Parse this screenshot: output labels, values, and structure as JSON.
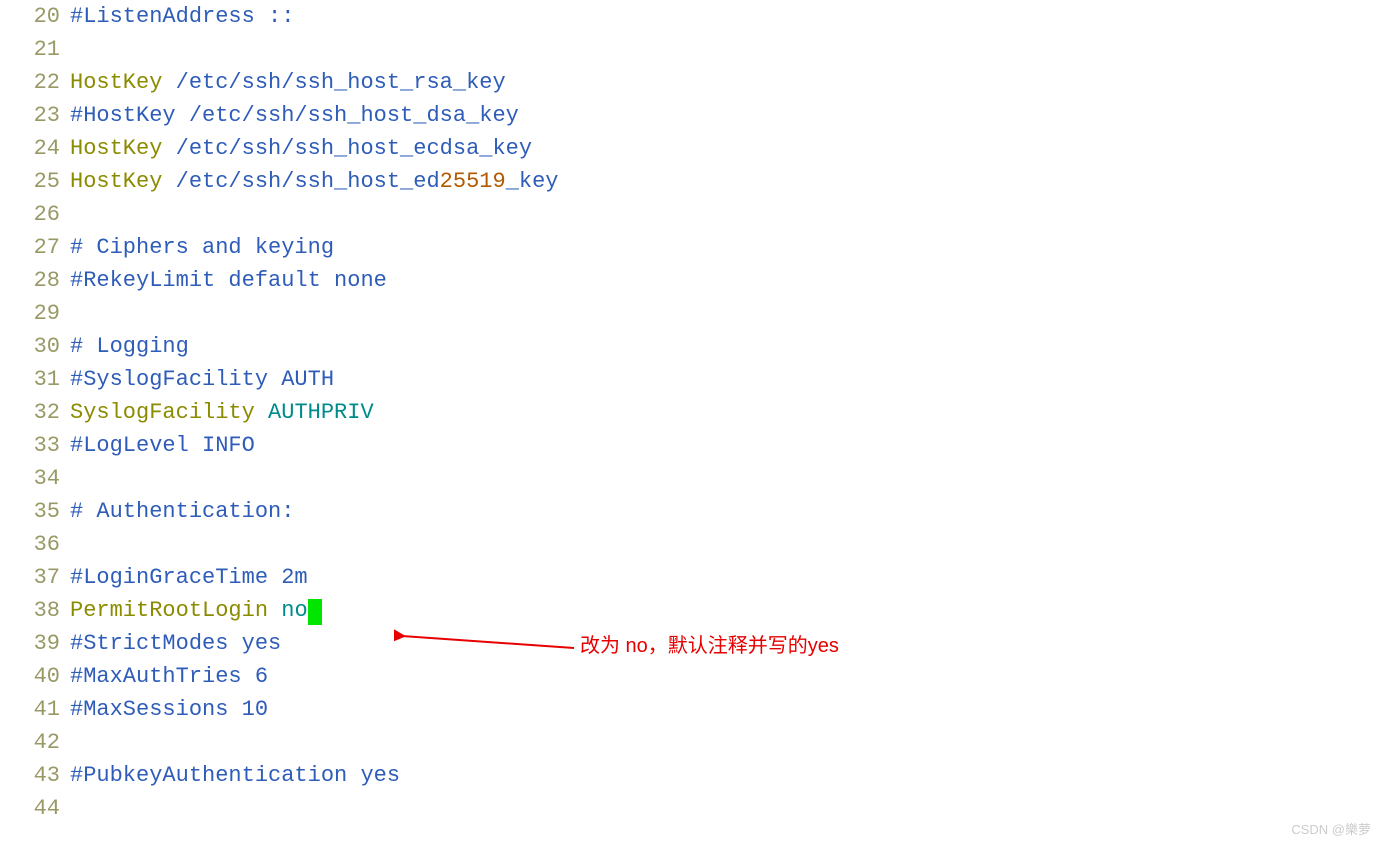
{
  "lines": [
    {
      "num": "20",
      "tokens": [
        {
          "cls": "comment",
          "t": "#ListenAddress ::"
        }
      ]
    },
    {
      "num": "21",
      "tokens": []
    },
    {
      "num": "22",
      "tokens": [
        {
          "cls": "directive",
          "t": "HostKey"
        },
        {
          "cls": "value",
          "t": " /etc/ssh/ssh_host_rsa_key"
        }
      ]
    },
    {
      "num": "23",
      "tokens": [
        {
          "cls": "comment",
          "t": "#HostKey /etc/ssh/ssh_host_dsa_key"
        }
      ]
    },
    {
      "num": "24",
      "tokens": [
        {
          "cls": "directive",
          "t": "HostKey"
        },
        {
          "cls": "value",
          "t": " /etc/ssh/ssh_host_ecdsa_key"
        }
      ]
    },
    {
      "num": "25",
      "tokens": [
        {
          "cls": "directive",
          "t": "HostKey"
        },
        {
          "cls": "value",
          "t": " /etc/ssh/ssh_host_ed"
        },
        {
          "cls": "number",
          "t": "25519"
        },
        {
          "cls": "value",
          "t": "_key"
        }
      ]
    },
    {
      "num": "26",
      "tokens": []
    },
    {
      "num": "27",
      "tokens": [
        {
          "cls": "comment",
          "t": "# Ciphers and keying"
        }
      ]
    },
    {
      "num": "28",
      "tokens": [
        {
          "cls": "comment",
          "t": "#RekeyLimit default none"
        }
      ]
    },
    {
      "num": "29",
      "tokens": []
    },
    {
      "num": "30",
      "tokens": [
        {
          "cls": "comment",
          "t": "# Logging"
        }
      ]
    },
    {
      "num": "31",
      "tokens": [
        {
          "cls": "comment",
          "t": "#SyslogFacility AUTH"
        }
      ]
    },
    {
      "num": "32",
      "tokens": [
        {
          "cls": "directive",
          "t": "SyslogFacility"
        },
        {
          "cls": "value",
          "t": " "
        },
        {
          "cls": "keyword",
          "t": "AUTHPRIV"
        }
      ]
    },
    {
      "num": "33",
      "tokens": [
        {
          "cls": "comment",
          "t": "#LogLevel INFO"
        }
      ]
    },
    {
      "num": "34",
      "tokens": []
    },
    {
      "num": "35",
      "tokens": [
        {
          "cls": "comment",
          "t": "# Authentication:"
        }
      ]
    },
    {
      "num": "36",
      "tokens": []
    },
    {
      "num": "37",
      "tokens": [
        {
          "cls": "comment",
          "t": "#LoginGraceTime 2m"
        }
      ]
    },
    {
      "num": "38",
      "tokens": [
        {
          "cls": "directive",
          "t": "PermitRootLogin"
        },
        {
          "cls": "value",
          "t": " "
        },
        {
          "cls": "keyword",
          "t": "no"
        }
      ],
      "cursor": true
    },
    {
      "num": "39",
      "tokens": [
        {
          "cls": "comment",
          "t": "#StrictModes yes"
        }
      ]
    },
    {
      "num": "40",
      "tokens": [
        {
          "cls": "comment",
          "t": "#MaxAuthTries 6"
        }
      ]
    },
    {
      "num": "41",
      "tokens": [
        {
          "cls": "comment",
          "t": "#MaxSessions 10"
        }
      ]
    },
    {
      "num": "42",
      "tokens": []
    },
    {
      "num": "43",
      "tokens": [
        {
          "cls": "comment",
          "t": "#PubkeyAuthentication yes"
        }
      ]
    },
    {
      "num": "44",
      "tokens": []
    }
  ],
  "annotation": "改为 no，默认注释并写的yes",
  "watermark": "CSDN @樂萝"
}
